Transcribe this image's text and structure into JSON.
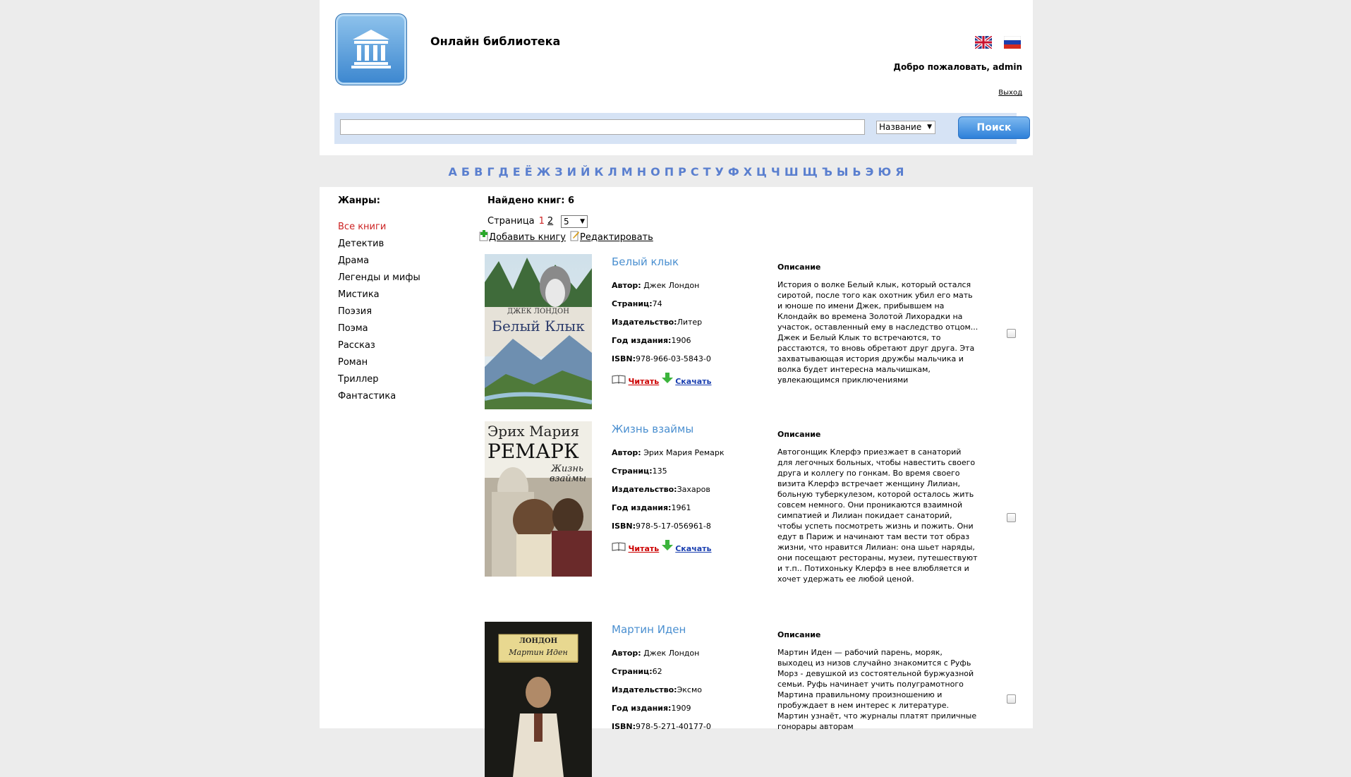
{
  "header": {
    "site_title": "Онлайн библиотека",
    "welcome": "Добро пожаловать, admin",
    "logout": "Выход"
  },
  "search": {
    "value": "",
    "field_selected": "Название",
    "button": "Поиск"
  },
  "alphabet": [
    "А",
    "Б",
    "В",
    "Г",
    "Д",
    "Е",
    "Ё",
    "Ж",
    "З",
    "И",
    "Й",
    "К",
    "Л",
    "М",
    "Н",
    "О",
    "П",
    "Р",
    "С",
    "Т",
    "У",
    "Ф",
    "Х",
    "Ц",
    "Ч",
    "Ш",
    "Щ",
    "Ъ",
    "Ы",
    "Ь",
    "Э",
    "Ю",
    "Я"
  ],
  "sidebar": {
    "title": "Жанры:",
    "genres": [
      "Все книги",
      "Детектив",
      "Драма",
      "Легенды и мифы",
      "Мистика",
      "Поэзия",
      "Поэма",
      "Рассказ",
      "Роман",
      "Триллер",
      "Фантастика"
    ],
    "active_index": 0
  },
  "main": {
    "found": "Найдено книг: 6",
    "page_label": "Страница",
    "pages": [
      "1",
      "2"
    ],
    "current_page": "1",
    "per_page": "5",
    "add_book": "Добавить книгу",
    "edit": "Редактировать"
  },
  "labels": {
    "author": "Автор:",
    "pages": "Страниц:",
    "publisher": "Издательство:",
    "year": "Год издания:",
    "isbn": "ISBN:",
    "read": "Читать",
    "download": "Скачать",
    "description": "Описание"
  },
  "books": [
    {
      "title": "Белый клык",
      "author": "Джек Лондон",
      "pages": "74",
      "publisher": "Литер",
      "year": "1906",
      "isbn": "978-966-03-5843-0",
      "cover_author": "ДЖЕК ЛОНДОН",
      "cover_title": "Белый Клык",
      "description": "История о волке Белый клык, который остался сиротой, после того как охотник убил его мать и юноше по имени Джек, прибывшем на Клондайк во времена Золотой Лихорадки на участок, оставленный ему в наследство отцом... Джек и Белый Клык то встречаются, то расстаются, то вновь обретают друг друга. Эта захватывающая история дружбы мальчика и волка будет интересна мальчишкам, увлекающимся приключениями"
    },
    {
      "title": "Жизнь взаймы",
      "author": "Эрих Мария Ремарк",
      "pages": "135",
      "publisher": "Захаров",
      "year": "1961",
      "isbn": "978-5-17-056961-8",
      "cover_author_1": "Эрих Мария",
      "cover_author_2": "РЕМАРК",
      "cover_title_1": "Жизнь",
      "cover_title_2": "взаймы",
      "description": "Автогонщик Клерфэ приезжает в санаторий для легочных больных, чтобы навестить своего друга и коллегу по гонкам. Во время своего визита Клерфэ встречает женщину Лилиан, больную туберкулезом, которой осталось жить совсем немного. Они проникаются взаимной симпатией и Лилиан покидает санаторий, чтобы успеть посмотреть жизнь и пожить. Они едут в Париж и начинают там вести тот образ жизни, что нравится Лилиан: она шьет наряды, они посещают рестораны, музеи, путешествуют и т.п.. Потихоньку Клерфэ в нее влюбляется и хочет удержать ее любой ценой."
    },
    {
      "title": "Мартин Иден",
      "author": "Джек Лондон",
      "pages": "62",
      "publisher": "Эксмо",
      "year": "1909",
      "isbn": "978-5-271-40177-0",
      "cover_author": "ЛОНДОН",
      "cover_title": "Мартин Иден",
      "description": "Мартин Иден — рабочий парень, моряк, выходец из низов случайно знакомится с Руфь Морз - девушкой из состоятельной буржуазной семьи. Руфь начинает учить полуграмотного Мартина правильному произношению и пробуждает в нем интерес к литературе. Мартин узнаёт, что журналы платят приличные гонорары авторам"
    }
  ]
}
